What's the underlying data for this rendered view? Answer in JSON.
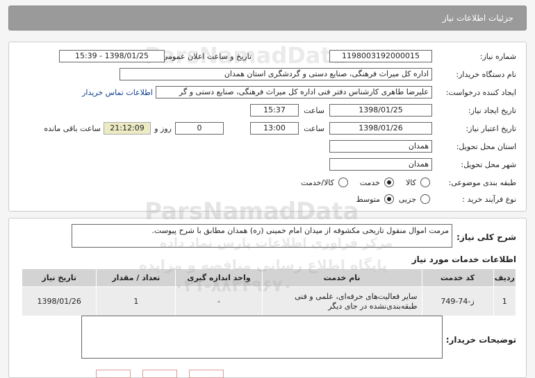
{
  "header": {
    "title": "جزئیات اطلاعات نیاز"
  },
  "form": {
    "need_number_label": "شماره نیاز:",
    "need_number": "1198003192000015",
    "announce_label": "تاریخ و ساعت اعلان عمومی:",
    "announce_value": "1398/01/25 - 15:39",
    "buyer_label": "نام دستگاه خریدار:",
    "buyer_value": "اداره کل میراث فرهنگی، صنایع دستی و گردشگری استان همدان",
    "requester_label": "ایجاد کننده درخواست:",
    "requester_value": "علیرضا طاهری کارشناس دفتر فنی اداره کل میراث فرهنگی، صنایع دستی و گر",
    "contact_link": "اطلاعات تماس خریدار",
    "created_label": "تاریخ ایجاد نیاز:",
    "created_date": "1398/01/25",
    "time_label": "ساعت",
    "created_time": "15:37",
    "validity_label": "تاریخ اعتبار نیاز:",
    "validity_date": "1398/01/26",
    "validity_time": "13:00",
    "days_value": "0",
    "days_label": "روز و",
    "remaining_value": "21:12:09",
    "remaining_label": "ساعت باقی مانده",
    "province_label": "استان محل تحویل:",
    "province_value": "همدان",
    "city_label": "شهر محل تحویل:",
    "city_value": "همدان",
    "category_label": "طبقه بندی موضوعی:",
    "category_options": [
      "کالا",
      "خدمت",
      "کالا/خدمت"
    ],
    "category_selected": "خدمت",
    "process_label": "نوع فرآیند خرید :",
    "process_options": [
      "جزیی",
      "متوسط"
    ],
    "process_selected": "متوسط"
  },
  "summary": {
    "label": "شرح کلی نیاز:",
    "text": "مرمت اموال منقول تاریخی مکشوفه از میدان امام خمینی (ره) همدان مطابق با شرح پیوست."
  },
  "services": {
    "title": "اطلاعات خدمات مورد نیاز",
    "columns": [
      "ردیف",
      "کد خدمت",
      "نام خدمت",
      "واحد اندازه گیری",
      "تعداد / مقدار",
      "تاریخ نیاز"
    ],
    "rows": [
      {
        "row": "1",
        "code": "ز-74-749",
        "name": "سایر فعالیت‌های حرفه‌ای، علمی و فنی طبقه‌بندی‌نشده در جای دیگر",
        "unit": "-",
        "qty": "1",
        "date": "1398/01/26"
      }
    ]
  },
  "buyer_notes": {
    "label": "توضیحات خریدار:"
  },
  "watermark": {
    "line1": "ParsNamadData",
    "line2": "مرکز فراوری اطلاعات پارس نماد داده",
    "line3": "پایگاه اطلاع رسانی مناقصه و مزایده",
    "line4": "۰۲۱-۸۸۳۴۹۶۷۰"
  },
  "colors": {
    "header": "#9a9a9a",
    "link": "#0a3c8c",
    "remaining_bg": "#ecebc4",
    "table_head": "#d3d3d3",
    "table_cell": "#ececec"
  }
}
